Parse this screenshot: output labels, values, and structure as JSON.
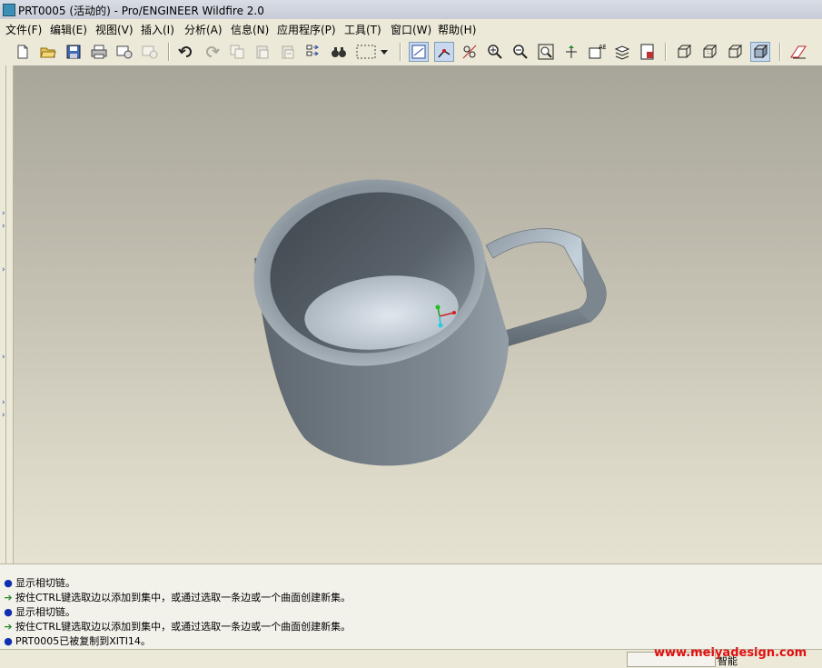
{
  "window": {
    "title": "PRT0005 (活动的) - Pro/ENGINEER Wildfire 2.0"
  },
  "menu": [
    {
      "label": "文件(F)"
    },
    {
      "label": "编辑(E)"
    },
    {
      "label": "视图(V)"
    },
    {
      "label": "插入(I)"
    },
    {
      "label": "分析(A)"
    },
    {
      "label": "信息(N)"
    },
    {
      "label": "应用程序(P)"
    },
    {
      "label": "工具(T)"
    },
    {
      "label": "窗口(W)"
    },
    {
      "label": "帮助(H)"
    }
  ],
  "messages": [
    {
      "icon": "bullet",
      "text": "显示相切链。"
    },
    {
      "icon": "arrow",
      "text": "按住CTRL键选取边以添加到集中，或通过选取一条边或一个曲面创建新集。"
    },
    {
      "icon": "bullet",
      "text": "显示相切链。"
    },
    {
      "icon": "arrow",
      "text": "按住CTRL键选取边以添加到集中，或通过选取一条边或一个曲面创建新集。"
    },
    {
      "icon": "bullet",
      "text": "PRT0005已被复制到XITI14。"
    }
  ],
  "status": {
    "filter": "智能",
    "watermark": "www.meiyadesign.com"
  },
  "colors": {
    "mug": "#7a838b",
    "background_top": "#a8a59a",
    "background_bottom": "#e6e2d2",
    "watermark": "#e01010"
  }
}
